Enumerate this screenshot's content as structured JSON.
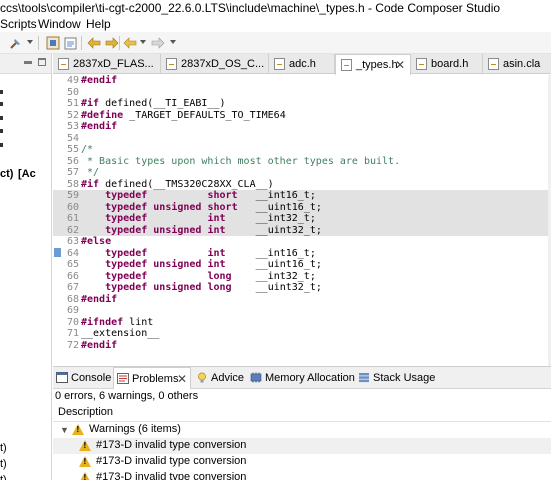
{
  "window": {
    "title": "ccs\\tools\\compiler\\ti-cgt-c2000_22.6.0.LTS\\include\\machine\\_types.h - Code Composer Studio"
  },
  "menu": {
    "items": [
      "Scripts",
      "Window",
      "Help"
    ]
  },
  "left_pane": {
    "lines": [
      "ct)",
      "[Ac",
      "t)",
      "t)",
      "t)"
    ]
  },
  "editor_tabs": [
    {
      "label": "2837xD_FLAS...",
      "active": false
    },
    {
      "label": "2837xD_OS_C...",
      "active": false
    },
    {
      "label": "adc.h",
      "active": false
    },
    {
      "label": "_types.h",
      "active": true,
      "close": "✕"
    },
    {
      "label": "board.h",
      "active": false
    },
    {
      "label": "asin.cla",
      "active": false
    }
  ],
  "code": [
    {
      "n": "49",
      "t": "#endif"
    },
    {
      "n": "50",
      "t": ""
    },
    {
      "n": "51",
      "t": "#if defined(__TI_EABI__)"
    },
    {
      "n": "52",
      "t": "#define _TARGET_DEFAULTS_TO_TIME64"
    },
    {
      "n": "53",
      "t": "#endif"
    },
    {
      "n": "54",
      "t": ""
    },
    {
      "n": "55",
      "t": "/*"
    },
    {
      "n": "56",
      "t": " * Basic types upon which most other types are built."
    },
    {
      "n": "57",
      "t": " */"
    },
    {
      "n": "58",
      "t": "#if defined(__TMS320C28XX_CLA__)"
    },
    {
      "n": "59",
      "t": "    typedef          short   __int16_t;"
    },
    {
      "n": "60",
      "t": "    typedef unsigned short   __uint16_t;"
    },
    {
      "n": "61",
      "t": "    typedef          int     __int32_t;"
    },
    {
      "n": "62",
      "t": "    typedef unsigned int     __uint32_t;"
    },
    {
      "n": "63",
      "t": "#else"
    },
    {
      "n": "64",
      "t": "    typedef          int     __int16_t;"
    },
    {
      "n": "65",
      "t": "    typedef unsigned int     __uint16_t;"
    },
    {
      "n": "66",
      "t": "    typedef          long    __int32_t;"
    },
    {
      "n": "67",
      "t": "    typedef unsigned long    __uint32_t;"
    },
    {
      "n": "68",
      "t": "#endif"
    },
    {
      "n": "69",
      "t": ""
    },
    {
      "n": "70",
      "t": "#ifndef lint"
    },
    {
      "n": "71",
      "t": "__extension__"
    },
    {
      "n": "72",
      "t": "#endif"
    }
  ],
  "bottom_tabs": [
    {
      "label": "Console",
      "active": false
    },
    {
      "label": "Problems",
      "active": true,
      "close": "✕"
    },
    {
      "label": "Advice",
      "active": false
    },
    {
      "label": "Memory Allocation",
      "active": false
    },
    {
      "label": "Stack Usage",
      "active": false
    }
  ],
  "problems": {
    "summary": "0 errors, 6 warnings, 0 others",
    "column_header": "Description",
    "group": {
      "label": "Warnings (6 items)",
      "expanded": true
    },
    "items": [
      "#173-D invalid type conversion",
      "#173-D invalid type conversion",
      "#173-D invalid type conversion"
    ]
  },
  "colors": {
    "keyword": "#7f0055",
    "comment": "#3f7f5f",
    "line_highlight": "#e2e2e2",
    "warning": "#e8b21c"
  }
}
